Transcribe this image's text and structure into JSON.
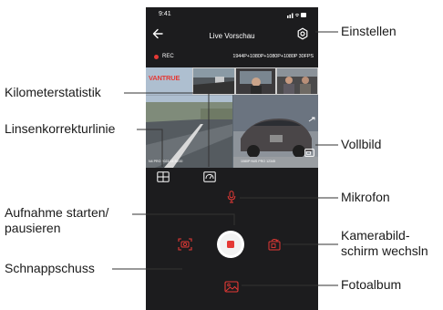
{
  "status_bar": {
    "time": "9:41"
  },
  "nav": {
    "title": "Live Vorschau",
    "back_icon": "arrow-left-icon",
    "settings_icon": "gear-icon"
  },
  "recording": {
    "rec_label": "REC",
    "info": "1944P+1080P+1080P+1080P 30FPS"
  },
  "preview": {
    "brand": "VANTRUE",
    "overlay_left": "N4 PRO 2023 14:30:00",
    "overlay_right": "1080P  N4S PRO  12345",
    "fullscreen_icon": "fullscreen-icon"
  },
  "controls": {
    "grid_icon": "grid-icon",
    "km_icon": "speedometer-icon",
    "mic_icon": "microphone-icon",
    "record_icon": "record-stop-icon",
    "snapshot_icon": "camera-snapshot-icon",
    "switch_icon": "camera-switch-icon",
    "album_icon": "photo-album-icon"
  },
  "callouts": {
    "einstellen": "Einstellen",
    "kilometer": "Kilometerstatistik",
    "linsen": "Linsenkorrekturlinie",
    "vollbild": "Vollbild",
    "mikrofon": "Mikrofon",
    "aufnahme_1": "Aufnahme starten/",
    "aufnahme_2": "pausieren",
    "kamera_1": "Kamerabild-",
    "kamera_2": "schirm wechsln",
    "schnapp": "Schnappschuss",
    "foto": "Fotoalbum"
  },
  "colors": {
    "phone_bg": "#1c1c1e",
    "accent": "#e53935",
    "text": "#1a1a1a"
  }
}
